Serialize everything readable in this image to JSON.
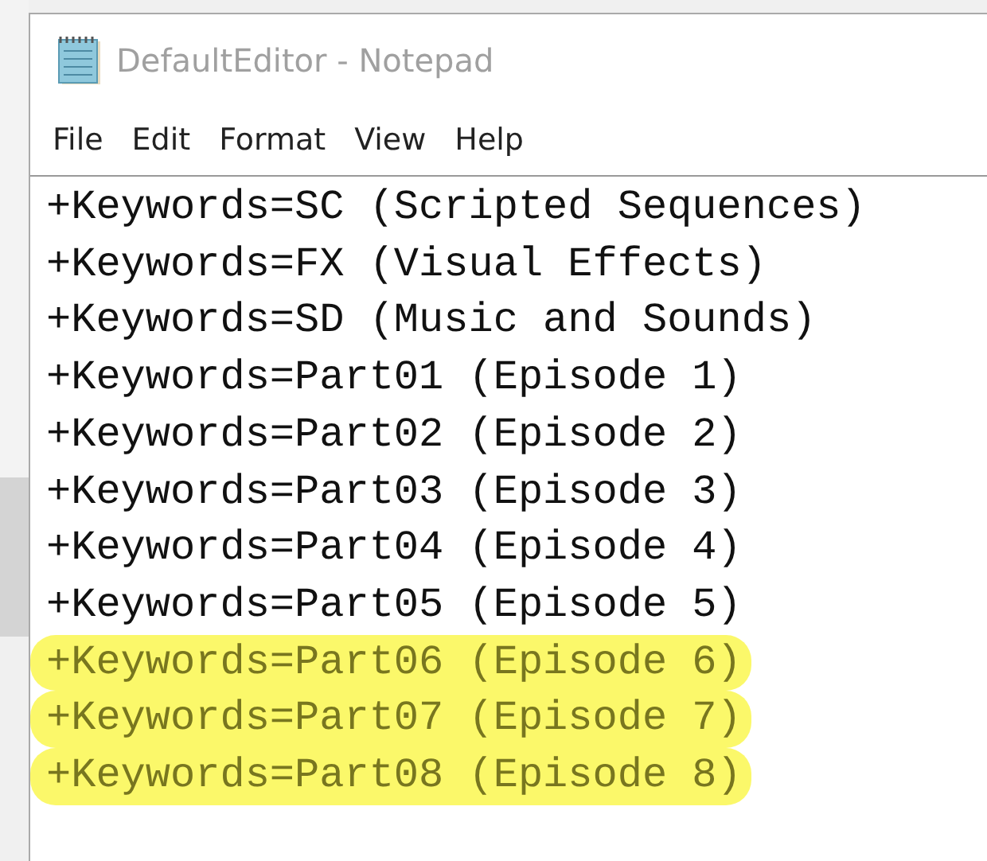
{
  "window": {
    "title": "DefaultEditor - Notepad"
  },
  "menu": [
    "File",
    "Edit",
    "Format",
    "View",
    "Help"
  ],
  "lines": [
    {
      "text": "+Keywords=SC (Scripted Sequences)",
      "highlighted": false
    },
    {
      "text": "+Keywords=FX (Visual Effects)",
      "highlighted": false
    },
    {
      "text": "+Keywords=SD (Music and Sounds)",
      "highlighted": false
    },
    {
      "text": "+Keywords=Part01 (Episode 1)",
      "highlighted": false
    },
    {
      "text": "+Keywords=Part02 (Episode 2)",
      "highlighted": false
    },
    {
      "text": "+Keywords=Part03 (Episode 3)",
      "highlighted": false
    },
    {
      "text": "+Keywords=Part04 (Episode 4)",
      "highlighted": false
    },
    {
      "text": "+Keywords=Part05 (Episode 5)",
      "highlighted": false
    },
    {
      "text": "+Keywords=Part06 (Episode 6)",
      "highlighted": true
    },
    {
      "text": "+Keywords=Part07 (Episode 7)",
      "highlighted": true
    },
    {
      "text": "+Keywords=Part08 (Episode 8)",
      "highlighted": true
    }
  ]
}
